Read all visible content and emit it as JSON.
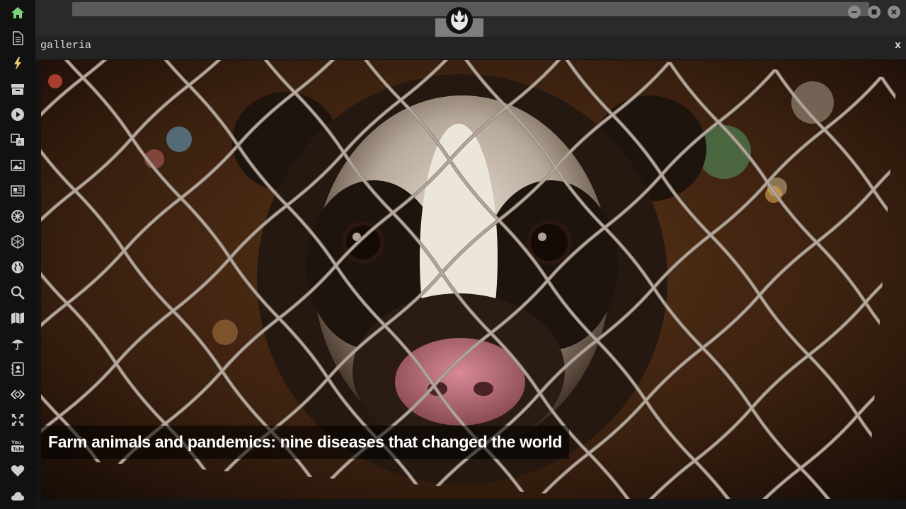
{
  "sidebar": {
    "items": [
      {
        "icon": "home-icon",
        "color": "#7ed17e"
      },
      {
        "icon": "document-icon",
        "color": "#cfcfcf"
      },
      {
        "icon": "lightning-icon",
        "color": "#e6c96a"
      },
      {
        "icon": "archive-icon",
        "color": "#cfcfcf"
      },
      {
        "icon": "play-icon",
        "color": "#cfcfcf"
      },
      {
        "icon": "translate-icon",
        "color": "#cfcfcf"
      },
      {
        "icon": "image-icon",
        "color": "#cfcfcf"
      },
      {
        "icon": "newspaper-icon",
        "color": "#cfcfcf"
      },
      {
        "icon": "helm-icon",
        "color": "#cfcfcf"
      },
      {
        "icon": "hexagon-icon",
        "color": "#cfcfcf"
      },
      {
        "icon": "globe-icon",
        "color": "#cfcfcf"
      },
      {
        "icon": "search-icon",
        "color": "#cfcfcf"
      },
      {
        "icon": "map-icon",
        "color": "#cfcfcf"
      },
      {
        "icon": "umbrella-icon",
        "color": "#cfcfcf"
      },
      {
        "icon": "contact-icon",
        "color": "#cfcfcf"
      },
      {
        "icon": "code-icon",
        "color": "#cfcfcf"
      },
      {
        "icon": "expand-icon",
        "color": "#cfcfcf"
      },
      {
        "icon": "youtube-icon",
        "color": "#cfcfcf"
      },
      {
        "icon": "heart-icon",
        "color": "#cfcfcf"
      },
      {
        "icon": "cloud-icon",
        "color": "#cfcfcf"
      }
    ]
  },
  "window": {
    "logo_icon": "rebel-alliance-icon",
    "controls": [
      "minimize-icon",
      "maximize-icon",
      "close-icon"
    ]
  },
  "panel": {
    "title": "galleria",
    "close_label": "x"
  },
  "gallery": {
    "caption": "Farm animals and pandemics: nine diseases that changed the world"
  }
}
